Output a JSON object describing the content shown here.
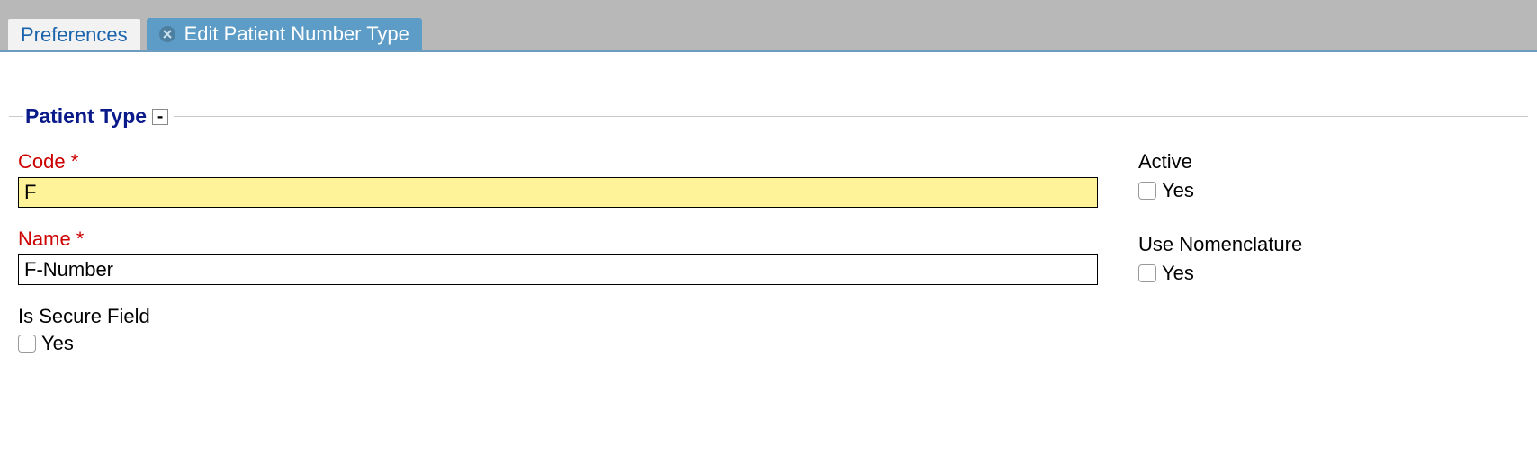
{
  "tabs": [
    {
      "label": "Preferences",
      "active": false,
      "closable": false
    },
    {
      "label": "Edit Patient Number Type",
      "active": true,
      "closable": true
    }
  ],
  "group": {
    "title": "Patient Type",
    "collapse_glyph": "-"
  },
  "fields": {
    "code": {
      "label": "Code",
      "value": "F"
    },
    "name": {
      "label": "Name",
      "value": "F-Number"
    },
    "is_secure": {
      "label": "Is Secure Field",
      "option": "Yes",
      "checked": false
    },
    "active": {
      "label": "Active",
      "option": "Yes",
      "checked": false
    },
    "use_nomenclature": {
      "label": "Use Nomenclature",
      "option": "Yes",
      "checked": false
    }
  }
}
